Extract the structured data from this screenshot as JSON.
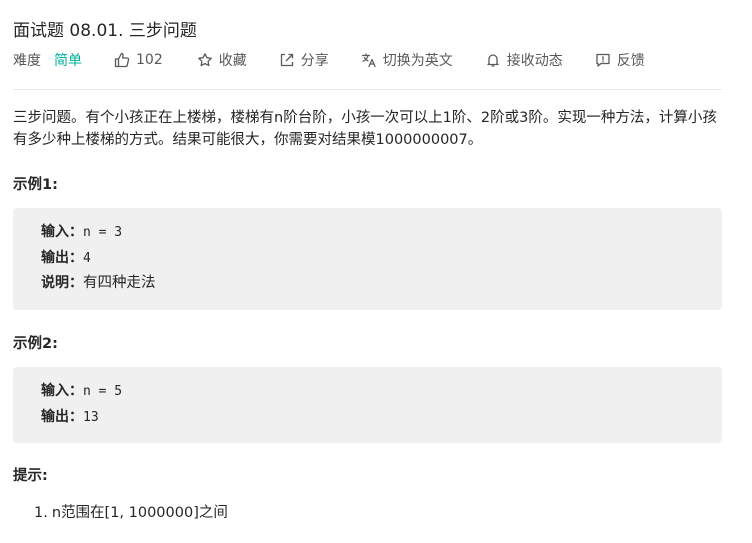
{
  "problem": {
    "title": "面试题 08.01. 三步问题",
    "difficulty_label": "难度",
    "difficulty_value": "简单",
    "likes": "102",
    "favorite_label": "收藏",
    "share_label": "分享",
    "switch_lang_label": "切换为英文",
    "notify_label": "接收动态",
    "feedback_label": "反馈",
    "description": "三步问题。有个小孩正在上楼梯，楼梯有n阶台阶，小孩一次可以上1阶、2阶或3阶。实现一种方法，计算小孩有多少种上楼梯的方式。结果可能很大，你需要对结果模1000000007。"
  },
  "examples": [
    {
      "title": "示例1:",
      "input_key": "输入：",
      "input_value": "n = 3",
      "output_key": "输出：",
      "output_value": "4",
      "explain_key": "说明：",
      "explain_value": "有四种走法"
    },
    {
      "title": "示例2:",
      "input_key": "输入：",
      "input_value": "n = 5",
      "output_key": "输出：",
      "output_value": "13"
    }
  ],
  "hints": {
    "title": "提示:",
    "items": [
      {
        "num": "1.",
        "text": "n范围在[1, 1000000]之间"
      }
    ]
  },
  "colors": {
    "difficulty_easy": "#00af9b",
    "example_bg": "#f0f0f0",
    "divider": "#e8e8e8"
  },
  "icons": [
    "thumbs-up-icon",
    "star-icon",
    "share-icon",
    "translate-icon",
    "bell-icon",
    "feedback-icon"
  ]
}
